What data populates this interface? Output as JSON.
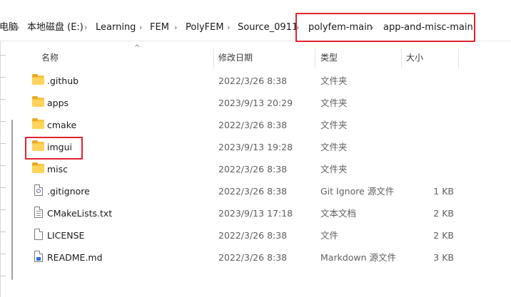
{
  "breadcrumb": {
    "items": [
      "电脑",
      "本地磁盘 (E:)",
      "Learning",
      "FEM",
      "PolyFEM",
      "Source_0911",
      "polyfem-main",
      "app-and-misc-main"
    ]
  },
  "columns": {
    "name": "名称",
    "date": "修改日期",
    "type": "类型",
    "size": "大小"
  },
  "files": [
    {
      "name": ".github",
      "date": "2022/3/26 8:38",
      "type": "文件夹",
      "size": "",
      "icon": "folder-icon"
    },
    {
      "name": "apps",
      "date": "2023/9/13 20:29",
      "type": "文件夹",
      "size": "",
      "icon": "folder-icon"
    },
    {
      "name": "cmake",
      "date": "2022/3/26 8:38",
      "type": "文件夹",
      "size": "",
      "icon": "folder-icon"
    },
    {
      "name": "imgui",
      "date": "2023/9/13 19:28",
      "type": "文件夹",
      "size": "",
      "icon": "folder-icon"
    },
    {
      "name": "misc",
      "date": "2022/3/26 8:38",
      "type": "文件夹",
      "size": "",
      "icon": "folder-icon"
    },
    {
      "name": ".gitignore",
      "date": "2022/3/26 8:38",
      "type": "Git Ignore 源文件",
      "size": "1 KB",
      "icon": "settings-file-icon"
    },
    {
      "name": "CMakeLists.txt",
      "date": "2023/9/13 17:18",
      "type": "文本文档",
      "size": "2 KB",
      "icon": "text-file-icon"
    },
    {
      "name": "LICENSE",
      "date": "2022/3/26 8:38",
      "type": "文件",
      "size": "2 KB",
      "icon": "file-icon"
    },
    {
      "name": "README.md",
      "date": "2022/3/26 8:38",
      "type": "Markdown 源文件",
      "size": "3 KB",
      "icon": "markdown-file-icon"
    }
  ],
  "colors": {
    "highlight": "#e0242f",
    "folder": "#ffd35c"
  }
}
